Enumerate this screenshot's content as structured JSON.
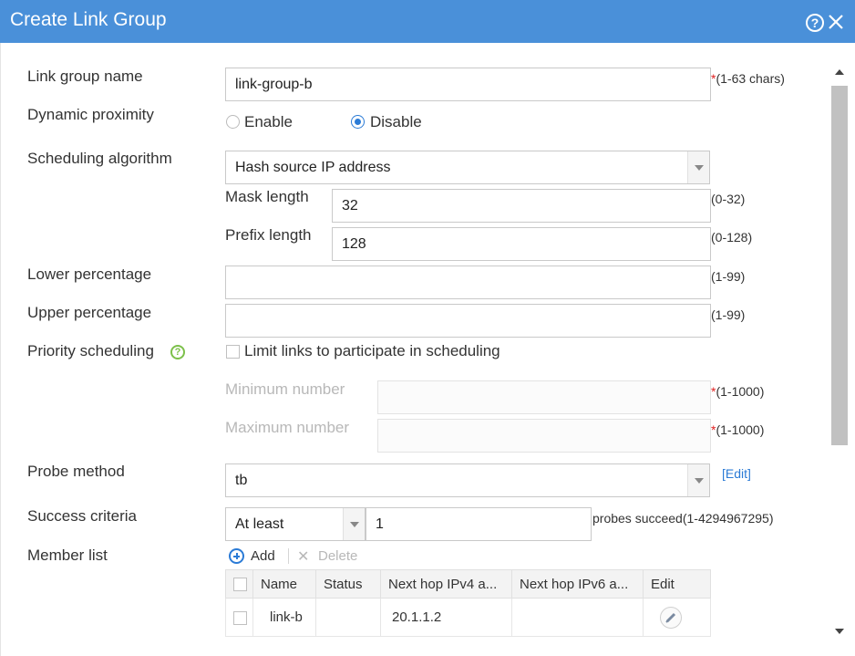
{
  "dialog": {
    "title": "Create Link Group",
    "help_glyph": "?",
    "icons": {
      "help": "help-icon",
      "close": "close-icon"
    },
    "accent_color": "#4a90d9"
  },
  "form": {
    "link_group_name": {
      "label": "Link group name",
      "value": "link-group-b",
      "required_mark": "*",
      "hint": "(1-63 chars)"
    },
    "dynamic_proximity": {
      "label": "Dynamic proximity",
      "options": [
        "Enable",
        "Disable"
      ],
      "selected": "Disable"
    },
    "scheduling_algorithm": {
      "label": "Scheduling algorithm",
      "value": "Hash source IP address",
      "mask_length": {
        "label": "Mask length",
        "value": "32",
        "hint": "(0-32)"
      },
      "prefix_length": {
        "label": "Prefix length",
        "value": "128",
        "hint": "(0-128)"
      }
    },
    "lower_percentage": {
      "label": "Lower percentage",
      "value": "",
      "hint": "(1-99)"
    },
    "upper_percentage": {
      "label": "Upper percentage",
      "value": "",
      "hint": "(1-99)"
    },
    "priority_scheduling": {
      "label": "Priority scheduling",
      "help_glyph": "?",
      "checkbox_label": "Limit links to participate in scheduling",
      "checked": false,
      "minimum": {
        "label": "Minimum number",
        "value": "",
        "required_mark": "*",
        "hint": "(1-1000)"
      },
      "maximum": {
        "label": "Maximum number",
        "value": "",
        "required_mark": "*",
        "hint": "(1-1000)"
      }
    },
    "probe_method": {
      "label": "Probe method",
      "value": "tb",
      "edit_link": "[Edit]"
    },
    "success_criteria": {
      "label": "Success criteria",
      "mode": "At least",
      "count": "1",
      "hint": "probes succeed(1-4294967295)"
    },
    "member_list": {
      "label": "Member list",
      "add_label": "Add",
      "delete_label": "Delete",
      "delete_glyph": "✕",
      "columns": [
        "Name",
        "Status",
        "Next hop IPv4 a...",
        "Next hop IPv6 a...",
        "Edit"
      ],
      "rows": [
        {
          "name": "link-b",
          "status": "",
          "ipv4": "20.1.1.2",
          "ipv6": ""
        }
      ]
    }
  }
}
